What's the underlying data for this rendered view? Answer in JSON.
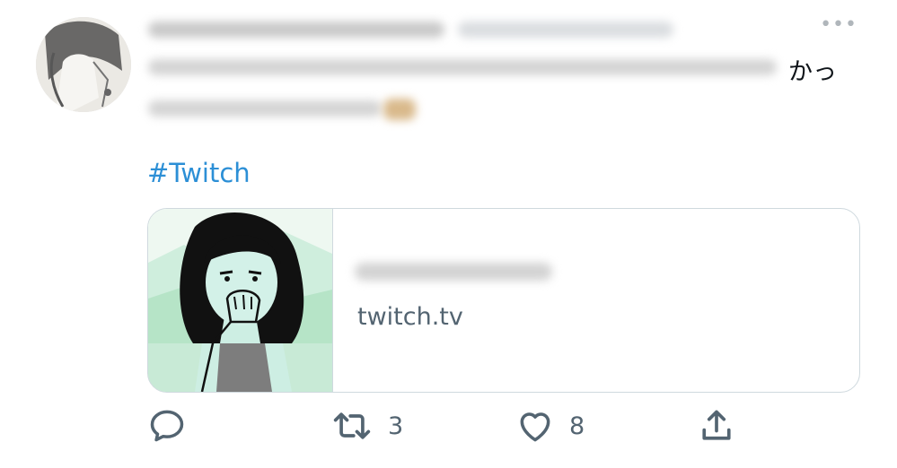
{
  "tweet": {
    "author": {
      "display_name": "",
      "handle": ""
    },
    "more_label": "•••",
    "text_tail": "かっ",
    "hashtag": "#Twitch",
    "card": {
      "title": "",
      "domain": "twitch.tv"
    },
    "actions": {
      "reply_count": "",
      "retweet_count": "3",
      "like_count": "8"
    },
    "colors": {
      "link": "#2c8fd6",
      "secondary_text": "#536471",
      "border": "#cfd9de"
    },
    "icons": [
      "reply-icon",
      "retweet-icon",
      "like-icon",
      "share-icon"
    ]
  }
}
